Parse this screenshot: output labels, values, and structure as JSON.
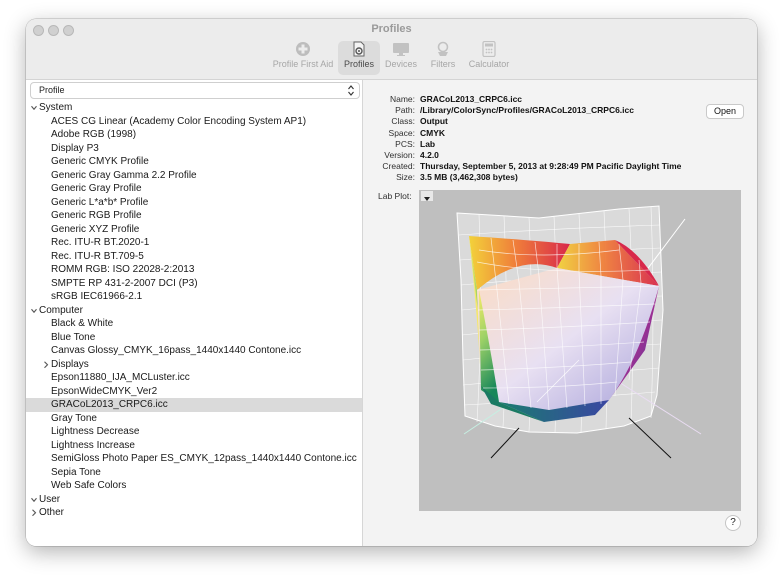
{
  "window": {
    "title": "Profiles",
    "toolbar": [
      {
        "label": "Profile First Aid",
        "icon": "first-aid-icon",
        "active": false
      },
      {
        "label": "Profiles",
        "icon": "profiles-icon",
        "active": true
      },
      {
        "label": "Devices",
        "icon": "display-icon",
        "active": false
      },
      {
        "label": "Filters",
        "icon": "filters-icon",
        "active": false
      },
      {
        "label": "Calculator",
        "icon": "calculator-icon",
        "active": false
      }
    ]
  },
  "sidebar": {
    "popup_label": "Profile",
    "groups": {
      "system": {
        "label": "System",
        "items": [
          "ACES CG Linear (Academy Color Encoding System AP1)",
          "Adobe RGB (1998)",
          "Display P3",
          "Generic CMYK Profile",
          "Generic Gray Gamma 2.2 Profile",
          "Generic Gray Profile",
          "Generic L*a*b* Profile",
          "Generic RGB Profile",
          "Generic XYZ Profile",
          "Rec. ITU-R BT.2020-1",
          "Rec. ITU-R BT.709-5",
          "ROMM RGB: ISO 22028-2:2013",
          "SMPTE RP 431-2-2007 DCI (P3)",
          "sRGB IEC61966-2.1"
        ]
      },
      "computer": {
        "label": "Computer",
        "items": [
          "Black & White",
          "Blue Tone",
          "Canvas Glossy_CMYK_16pass_1440x1440 Contone.icc",
          "Displays",
          "Epson11880_IJA_MCLuster.icc",
          "EpsonWideCMYK_Ver2",
          "GRACoL2013_CRPC6.icc",
          "Gray Tone",
          "Lightness Decrease",
          "Lightness Increase",
          "SemiGloss Photo Paper ES_CMYK_12pass_1440x1440 Contone.icc",
          "Sepia Tone",
          "Web Safe Colors"
        ]
      },
      "user": {
        "label": "User"
      },
      "other": {
        "label": "Other"
      }
    },
    "selected": "GRACoL2013_CRPC6.icc"
  },
  "details": {
    "rows": [
      {
        "key": "Name:",
        "value": "GRACoL2013_CRPC6.icc"
      },
      {
        "key": "Path:",
        "value": "/Library/ColorSync/Profiles/GRACoL2013_CRPC6.icc"
      },
      {
        "key": "Class:",
        "value": "Output"
      },
      {
        "key": "Space:",
        "value": "CMYK"
      },
      {
        "key": "PCS:",
        "value": "Lab"
      },
      {
        "key": "Version:",
        "value": "4.2.0"
      },
      {
        "key": "Created:",
        "value": "Thursday, September 5, 2013 at 9:28:49 PM Pacific Daylight Time"
      },
      {
        "key": "Size:",
        "value": "3.5 MB (3,462,308 bytes)"
      }
    ],
    "open_label": "Open",
    "plot_label": "Lab Plot:",
    "help_label": "?"
  },
  "colors": {
    "selection": "#dadada",
    "plot_background": "#bfbfbf"
  }
}
